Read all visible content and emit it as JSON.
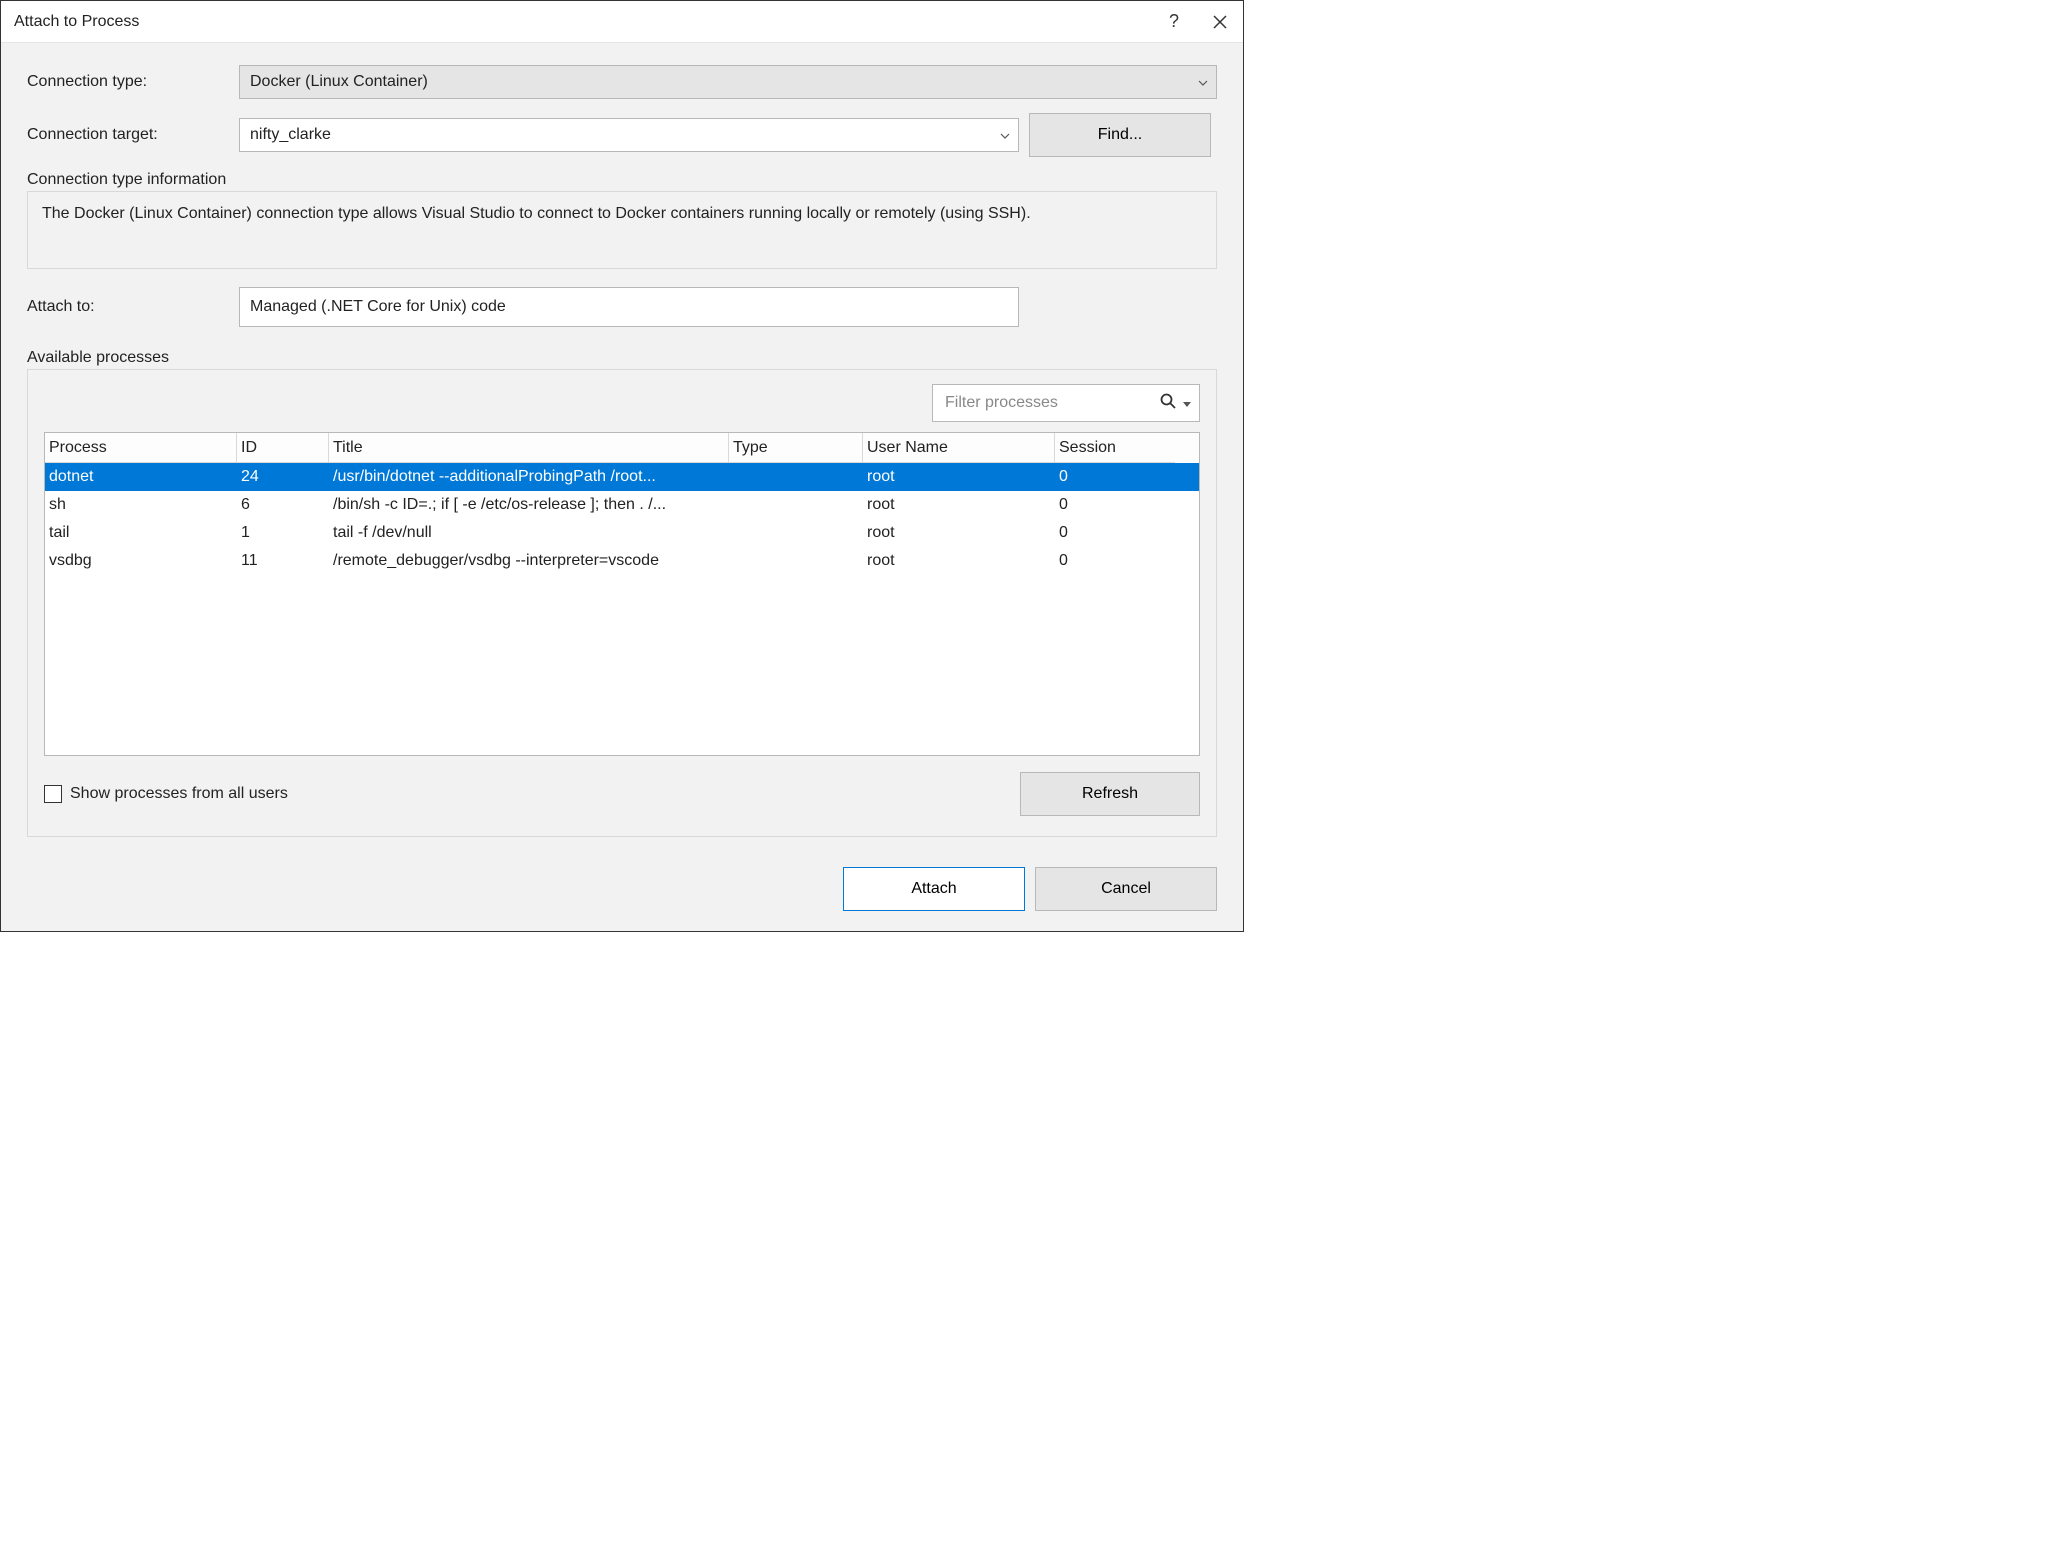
{
  "title": "Attach to Process",
  "labels": {
    "connection_type": "Connection type:",
    "connection_target": "Connection target:",
    "find": "Find...",
    "info_heading": "Connection type information",
    "info_text": "The Docker (Linux Container) connection type allows Visual Studio to connect to Docker containers running locally or remotely (using SSH).",
    "attach_to": "Attach to:",
    "available": "Available processes",
    "filter_placeholder": "Filter processes",
    "show_all": "Show processes from all users",
    "refresh": "Refresh",
    "attach": "Attach",
    "cancel": "Cancel"
  },
  "values": {
    "connection_type": "Docker (Linux Container)",
    "connection_target": "nifty_clarke",
    "attach_to": "Managed (.NET Core for Unix) code"
  },
  "columns": {
    "process": "Process",
    "id": "ID",
    "title": "Title",
    "type": "Type",
    "user": "User Name",
    "session": "Session"
  },
  "rows": [
    {
      "process": "dotnet",
      "id": "24",
      "title": "/usr/bin/dotnet --additionalProbingPath /root...",
      "type": "",
      "user": "root",
      "session": "0",
      "selected": true
    },
    {
      "process": "sh",
      "id": "6",
      "title": "/bin/sh -c ID=.; if [ -e /etc/os-release ]; then . /...",
      "type": "",
      "user": "root",
      "session": "0",
      "selected": false
    },
    {
      "process": "tail",
      "id": "1",
      "title": "tail -f /dev/null",
      "type": "",
      "user": "root",
      "session": "0",
      "selected": false
    },
    {
      "process": "vsdbg",
      "id": "11",
      "title": "/remote_debugger/vsdbg --interpreter=vscode",
      "type": "",
      "user": "root",
      "session": "0",
      "selected": false
    }
  ]
}
